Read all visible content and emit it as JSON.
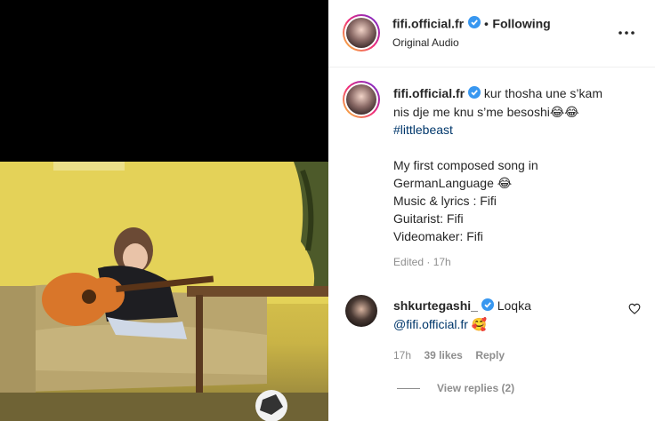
{
  "post": {
    "author": "fifi.official.fr",
    "audio": "Original Audio",
    "separator": "•",
    "follow_status": "Following",
    "more": "•••"
  },
  "caption": {
    "author": "fifi.official.fr",
    "line1": "kur thosha une s’kam",
    "line2": "nis dje me knu s’me besoshi😂😂",
    "hashtag": "#littlebeast",
    "body1": "My first composed song in",
    "body2": "GermanLanguage 😂",
    "body3": "Music & lyrics : Fifi",
    "body4": "Guitarist: Fifi",
    "body5": "Videomaker: Fifi",
    "edited": "Edited · 17h"
  },
  "comment": {
    "author": "shkurtegashi_",
    "text": "Loqka",
    "mention": "@fifi.official.fr",
    "emoji": "🥰",
    "time": "17h",
    "likes": "39 likes",
    "reply": "Reply",
    "view_replies": "View replies (2)"
  },
  "colors": {
    "verified": "#3897f0",
    "link": "#00376b",
    "muted": "#8e8e8e"
  }
}
